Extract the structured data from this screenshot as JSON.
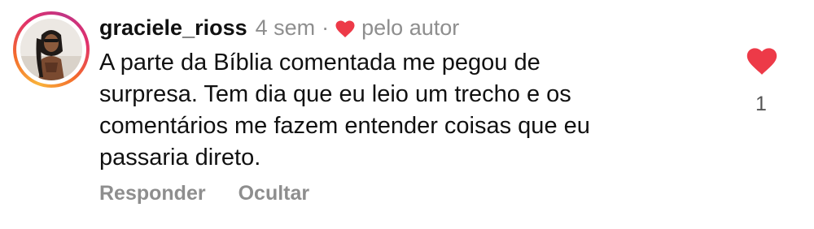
{
  "comment": {
    "username": "graciele_rioss",
    "time_ago": "4 sem",
    "separator": "·",
    "author_liked_label": "pelo autor",
    "text": "A parte da Bíblia comentada me pegou de\nsurpresa. Tem dia que eu leio um trecho e os\ncomentários me fazem entender coisas que eu\npassaria direto.",
    "actions": {
      "reply": "Responder",
      "hide": "Ocultar"
    },
    "like_count": "1"
  },
  "icons": {
    "author_heart": "heart-icon",
    "like": "heart-filled-icon"
  },
  "colors": {
    "heart": "#ed3a48",
    "muted_text": "#8e8e8e",
    "primary_text": "#111111"
  }
}
